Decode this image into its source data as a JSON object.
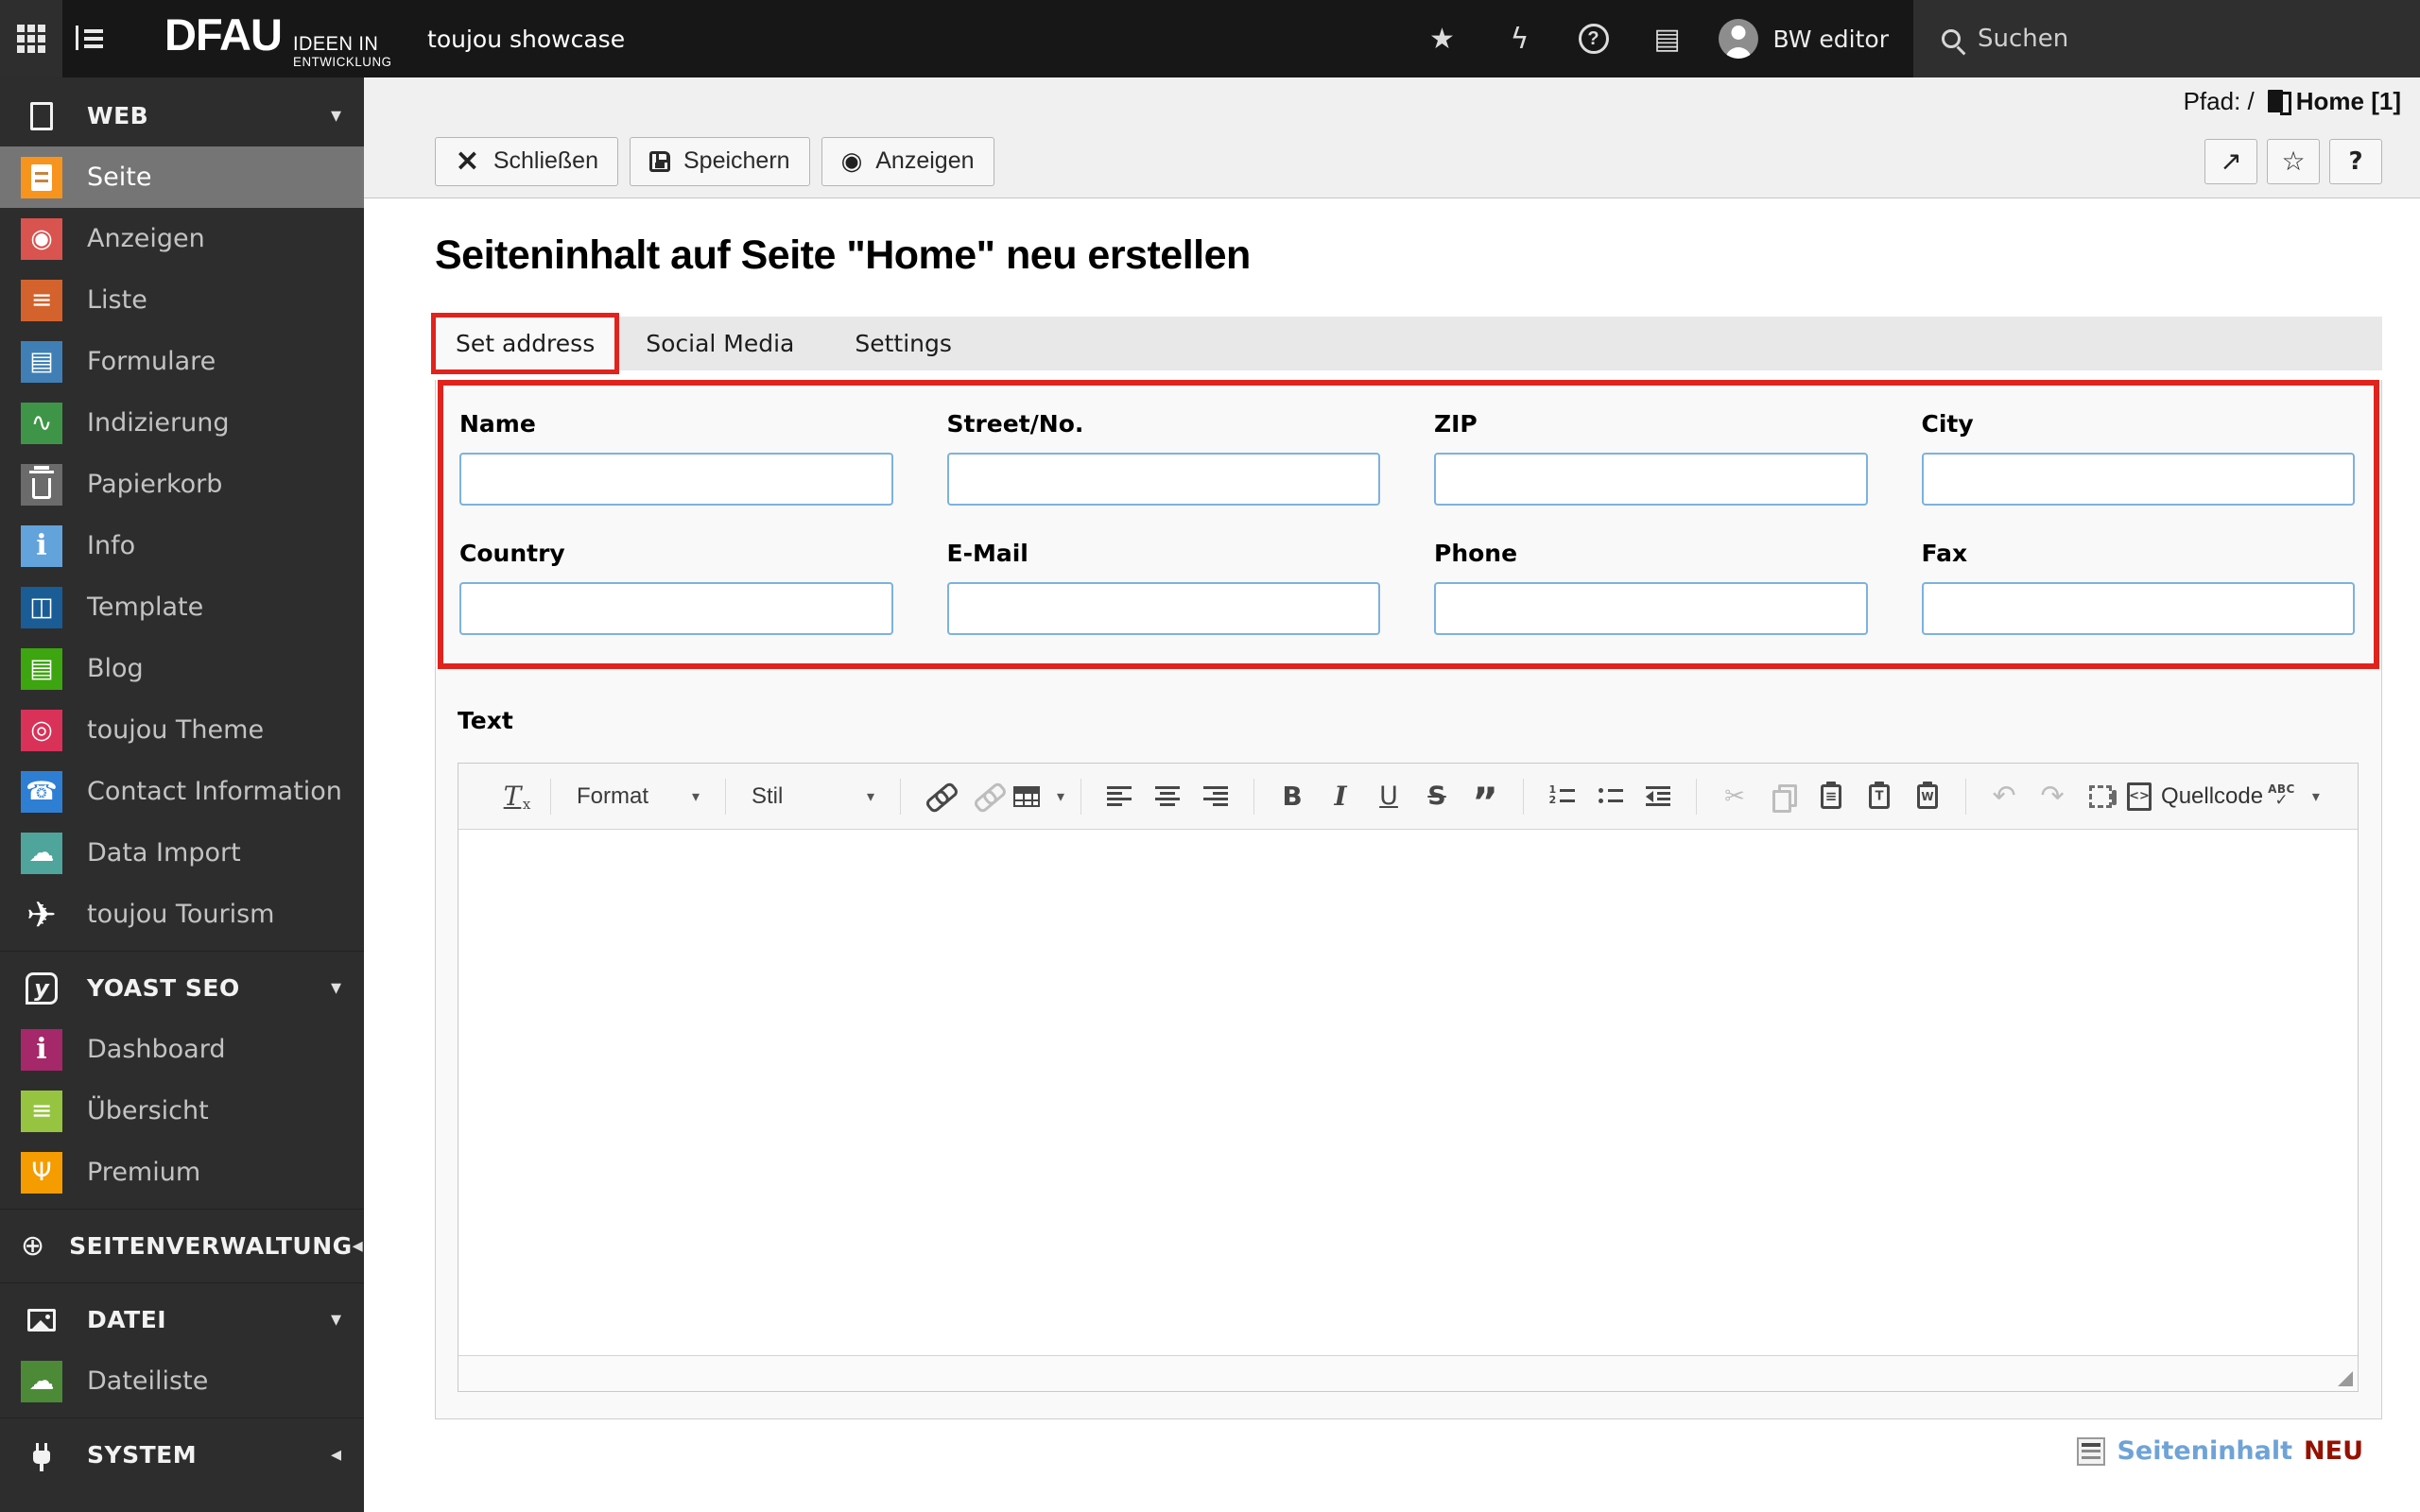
{
  "icons": {
    "caret_down": "▾",
    "caret_left": "◂",
    "star": "★",
    "bolt": "ϟ",
    "opendocs": "▤",
    "ext_arrow": "↗",
    "star_outline": "☆",
    "question": "?",
    "help_q": "?",
    "close_x": "×",
    "eye": "◉",
    "undo": "↶",
    "redo": "↷",
    "cut": "✂",
    "tx": "T",
    "src": "<>",
    "abc": "ABC",
    "check": "✓",
    "quote": "”",
    "bold": "B",
    "italic": "I",
    "underline": "U",
    "strike": "S"
  },
  "topbar": {
    "sitename": "toujou showcase",
    "username": "BW editor",
    "search_placeholder": "Suchen"
  },
  "logo": {
    "main": "DFAU",
    "tag1": "IDEEN IN",
    "tag2": "ENTWICKLUNG"
  },
  "sidebar": {
    "groups": [
      {
        "header": {
          "label": "WEB",
          "icon": "web-document",
          "icon_css": "i-doc-outline",
          "caret": "down"
        },
        "items": [
          {
            "label": "Seite",
            "color": "#f7941e",
            "icon_css": "i-docw",
            "active": true
          },
          {
            "label": "Anzeigen",
            "color": "#d9534f",
            "glyph": "◉"
          },
          {
            "label": "Liste",
            "color": "#d4622d",
            "glyph": "≡"
          },
          {
            "label": "Formulare",
            "color": "#3f7fb5",
            "glyph": "▤"
          },
          {
            "label": "Indizierung",
            "color": "#3f9547",
            "glyph": "∿"
          },
          {
            "label": "Papierkorb",
            "color": "#6b6b6b",
            "icon_css": "i-trash"
          },
          {
            "label": "Info",
            "color": "#63a3dc",
            "glyph": "i",
            "glyph_style": "g-info"
          },
          {
            "label": "Template",
            "color": "#1a5c96",
            "glyph": "◫"
          },
          {
            "label": "Blog",
            "color": "#3da50f",
            "glyph": "▤"
          },
          {
            "label": "toujou Theme",
            "color": "#d93158",
            "glyph": "◎"
          },
          {
            "label": "Contact Information",
            "color": "#2e7fd4",
            "glyph": "☎"
          },
          {
            "label": "Data Import",
            "color": "#4fa49c",
            "glyph": "☁"
          },
          {
            "label": "toujou Tourism",
            "color": "",
            "glyph": "✈"
          }
        ]
      },
      {
        "header": {
          "label": "YOAST SEO",
          "icon": "yoast-logo",
          "icon_css": "i-ybadge",
          "glyph": "y",
          "caret": "down"
        },
        "items": [
          {
            "label": "Dashboard",
            "color": "#a4286a",
            "glyph": "i",
            "glyph_style": "g-info"
          },
          {
            "label": "Übersicht",
            "color": "#97c440",
            "glyph": "≡"
          },
          {
            "label": "Premium",
            "color": "#f49c00",
            "glyph": "Ψ"
          }
        ]
      },
      {
        "header": {
          "label": "SEITENVERWALTUNG",
          "icon": "globe",
          "glyph": "⊕",
          "caret": "left"
        },
        "items": []
      },
      {
        "header": {
          "label": "DATEI",
          "icon": "image",
          "icon_css": "i-image",
          "caret": "down"
        },
        "items": [
          {
            "label": "Dateiliste",
            "color": "#4c8a38",
            "glyph": "☁"
          }
        ]
      },
      {
        "header": {
          "label": "SYSTEM",
          "icon": "plug",
          "icon_css": "i-plug",
          "caret": "left"
        },
        "items": []
      }
    ]
  },
  "docheader": {
    "path_label": "Pfad: /",
    "path_page": "Home [1]",
    "buttons": [
      {
        "label": "Schließen",
        "icon": "close"
      },
      {
        "label": "Speichern",
        "icon": "save"
      },
      {
        "label": "Anzeigen",
        "icon": "view"
      }
    ]
  },
  "content": {
    "title": "Seiteninhalt auf Seite \"Home\" neu erstellen",
    "tabs": [
      {
        "label": "Set address",
        "active": true
      },
      {
        "label": "Social Media",
        "active": false
      },
      {
        "label": "Settings",
        "active": false
      }
    ],
    "fields": [
      {
        "label": "Name",
        "value": ""
      },
      {
        "label": "Street/No.",
        "value": ""
      },
      {
        "label": "ZIP",
        "value": ""
      },
      {
        "label": "City",
        "value": ""
      },
      {
        "label": "Country",
        "value": ""
      },
      {
        "label": "E-Mail",
        "value": ""
      },
      {
        "label": "Phone",
        "value": ""
      },
      {
        "label": "Fax",
        "value": ""
      }
    ],
    "text_label": "Text",
    "editor": {
      "format": "Format",
      "stil": "Stil",
      "quellcode": "Quellcode",
      "toolbar": [
        {
          "type": "icon",
          "name": "remove-format",
          "cls": "i-tx",
          "glyph": "tx"
        },
        {
          "type": "sep"
        },
        {
          "type": "dropdown",
          "name": "format-dropdown",
          "label_key": "format"
        },
        {
          "type": "sep"
        },
        {
          "type": "dropdown",
          "name": "style-dropdown",
          "label_key": "stil"
        },
        {
          "type": "sep"
        },
        {
          "type": "icon",
          "name": "link",
          "cls": "i-link"
        },
        {
          "type": "icon",
          "name": "unlink",
          "cls": "i-link",
          "disabled": true
        },
        {
          "type": "icon",
          "name": "table",
          "cls": "i-table",
          "caret": true
        },
        {
          "type": "sep"
        },
        {
          "type": "icon",
          "name": "align-left",
          "cls": "i-al"
        },
        {
          "type": "icon",
          "name": "align-center",
          "cls": "i-ac"
        },
        {
          "type": "icon",
          "name": "align-right",
          "cls": "i-ar"
        },
        {
          "type": "sep"
        },
        {
          "type": "icon",
          "name": "bold",
          "cls": "i-b",
          "glyph": "bold"
        },
        {
          "type": "icon",
          "name": "italic",
          "cls": "i-i",
          "glyph": "italic"
        },
        {
          "type": "icon",
          "name": "underline",
          "cls": "i-u",
          "glyph": "underline"
        },
        {
          "type": "icon",
          "name": "strikethrough",
          "cls": "i-s",
          "glyph": "strike"
        },
        {
          "type": "icon",
          "name": "blockquote",
          "cls": "i-q",
          "glyph": "quote"
        },
        {
          "type": "sep"
        },
        {
          "type": "icon",
          "name": "numbered-list",
          "cls": "i-ol"
        },
        {
          "type": "icon",
          "name": "bullet-list",
          "cls": "i-ul"
        },
        {
          "type": "icon",
          "name": "indent",
          "cls": "i-ind"
        },
        {
          "type": "sep"
        },
        {
          "type": "icon",
          "name": "cut",
          "glyph": "cut",
          "disabled": true
        },
        {
          "type": "icon",
          "name": "copy",
          "cls": "i-copy",
          "disabled": true
        },
        {
          "type": "icon",
          "name": "paste",
          "cls": "i-clip i-paste"
        },
        {
          "type": "icon",
          "name": "paste-text",
          "cls": "i-clip i-paste-t"
        },
        {
          "type": "icon",
          "name": "paste-word",
          "cls": "i-clip i-paste-w"
        },
        {
          "type": "sep"
        },
        {
          "type": "icon",
          "name": "undo",
          "cls": "i-undo",
          "glyph": "undo",
          "disabled": true
        },
        {
          "type": "icon",
          "name": "redo",
          "cls": "i-redo",
          "glyph": "redo",
          "disabled": true
        },
        {
          "type": "icon",
          "name": "div-container",
          "cls": "i-div"
        },
        {
          "type": "source",
          "name": "source"
        },
        {
          "type": "spell",
          "name": "spellcheck",
          "caret": true
        }
      ]
    },
    "footer": {
      "type_label": "Seiteninhalt",
      "badge": "NEU"
    }
  }
}
